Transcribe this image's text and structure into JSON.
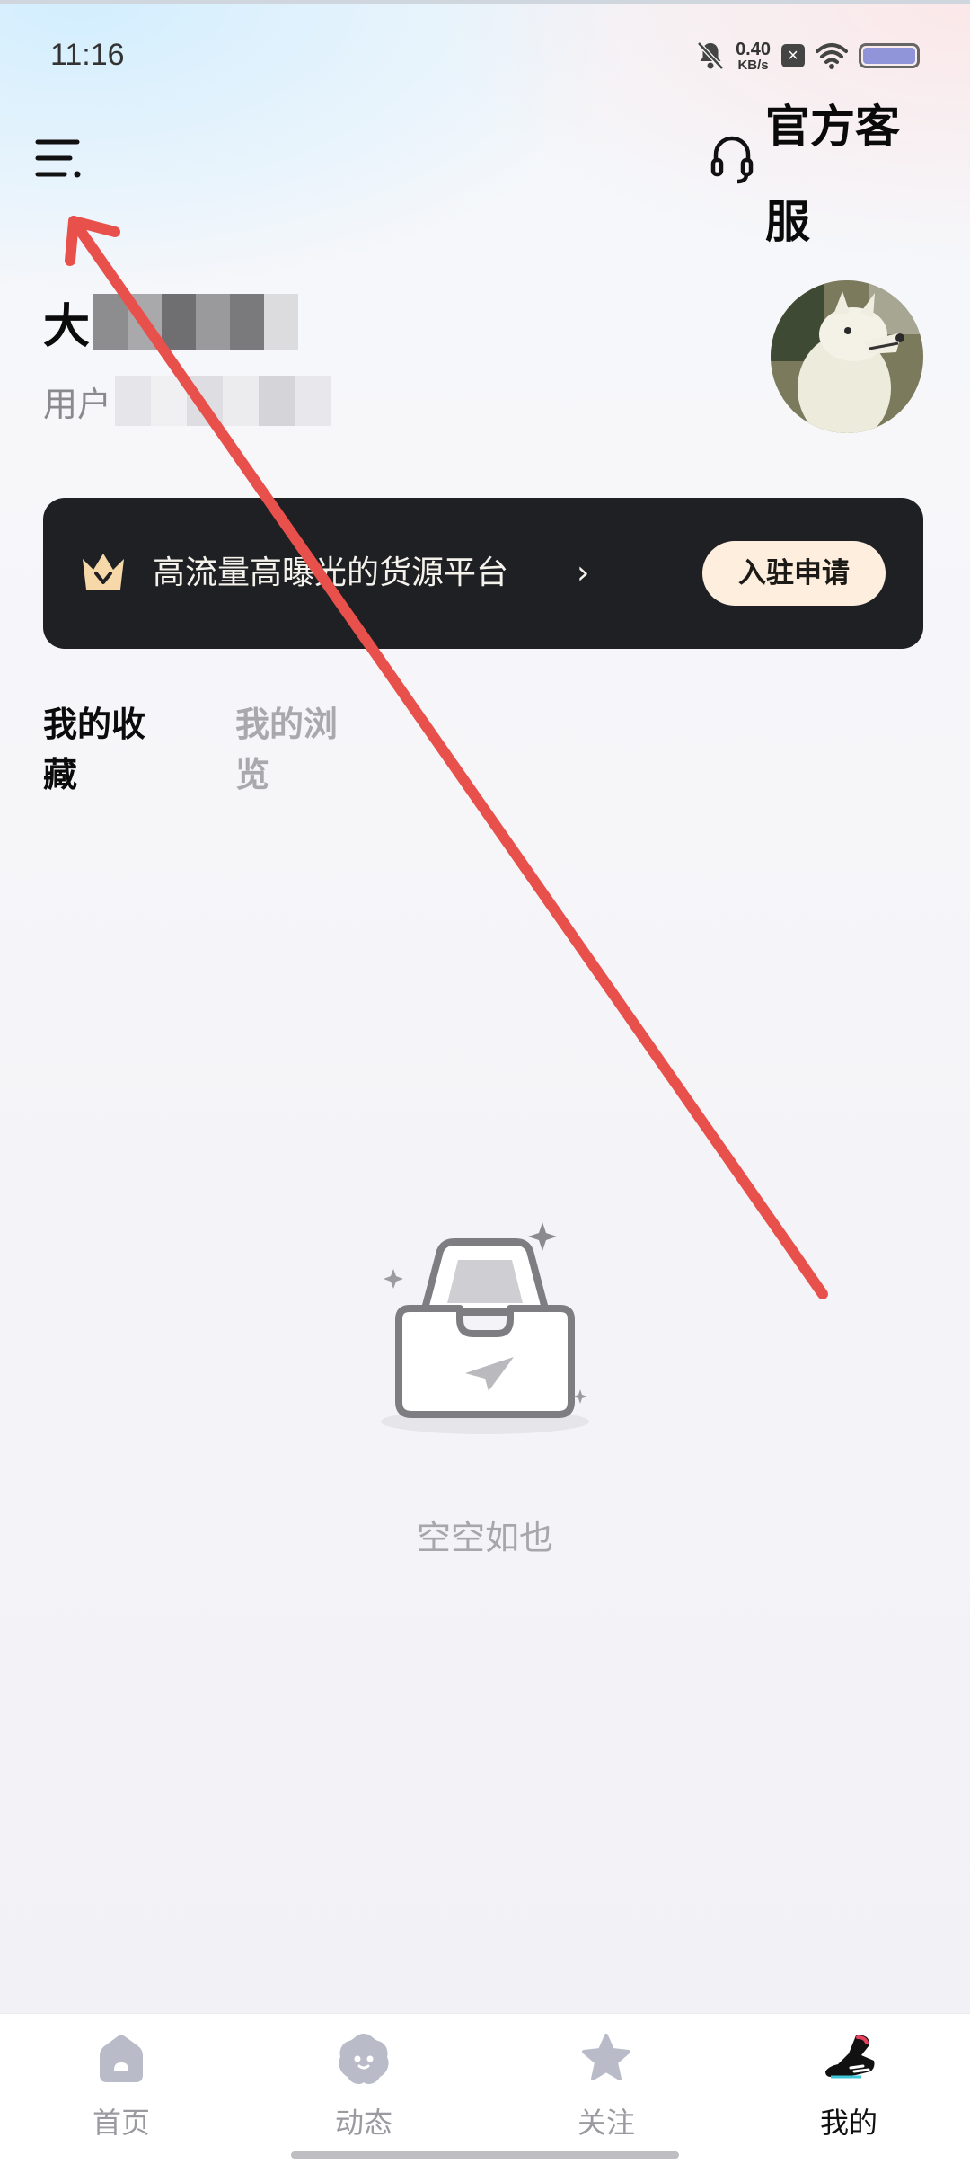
{
  "status_bar": {
    "time": "11:16",
    "net_speed_value": "0.40",
    "net_speed_unit": "KB/s",
    "icons": [
      "bell-muted-icon",
      "sim-blocked-icon",
      "wifi-icon",
      "battery-icon"
    ]
  },
  "header": {
    "menu_icon": "menu-icon",
    "customer_service_icon": "headset-icon",
    "customer_service_label": "官方客服"
  },
  "profile": {
    "name_visible": "大",
    "user_id_visible": "用户"
  },
  "banner": {
    "icon": "crown-icon",
    "text": "高流量高曝光的货源平台",
    "chevron": "›",
    "button_label": "入驻申请"
  },
  "tabs": [
    {
      "label": "我的收藏",
      "active": true
    },
    {
      "label": "我的浏览",
      "active": false
    }
  ],
  "empty_state": {
    "icon": "empty-inbox-icon",
    "text": "空空如也"
  },
  "bottom_nav": [
    {
      "label": "首页",
      "icon": "home-icon",
      "active": false
    },
    {
      "label": "动态",
      "icon": "moments-icon",
      "active": false
    },
    {
      "label": "关注",
      "icon": "star-icon",
      "active": false
    },
    {
      "label": "我的",
      "icon": "sneaker-icon",
      "active": true
    }
  ],
  "colors": {
    "banner_bg": "#1f2024",
    "apply_button_bg": "#fdeedd",
    "annotation_arrow": "#e8504c",
    "inactive_text": "#a8a8ad"
  }
}
